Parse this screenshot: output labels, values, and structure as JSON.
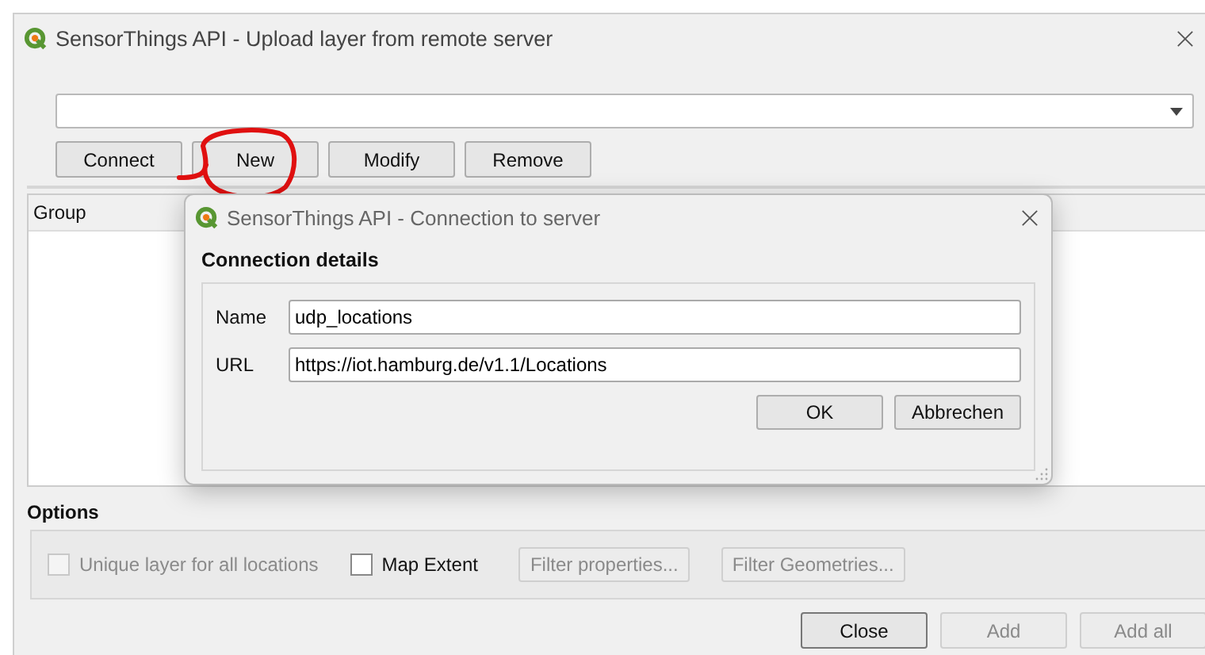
{
  "window": {
    "title": "SensorThings API - Upload layer from remote server"
  },
  "connection_buttons": [
    {
      "label": "Connect",
      "disabled": false
    },
    {
      "label": "New",
      "disabled": false
    },
    {
      "label": "Modify",
      "disabled": false
    },
    {
      "label": "Remove",
      "disabled": false
    }
  ],
  "table": {
    "columns": [
      "Group"
    ]
  },
  "options": {
    "title": "Options",
    "controls": [
      {
        "kind": "checkbox",
        "label": "Unique layer for all locations",
        "checked": false,
        "disabled": true
      },
      {
        "kind": "checkbox",
        "label": "Map Extent",
        "checked": false,
        "disabled": false
      },
      {
        "kind": "button",
        "label": "Filter properties...",
        "disabled": true
      },
      {
        "kind": "button",
        "label": "Filter Geometries...",
        "disabled": true
      }
    ]
  },
  "footer_buttons": [
    {
      "label": "Close",
      "disabled": false
    },
    {
      "label": "Add",
      "disabled": true
    },
    {
      "label": "Add all",
      "disabled": true
    }
  ],
  "annotation": {
    "kind": "circle"
  },
  "dialog": {
    "title": "SensorThings API - Connection to server",
    "section": "Connection details",
    "fields": [
      {
        "label": "Name",
        "value": "udp_locations"
      },
      {
        "label": "URL",
        "value": "https://iot.hamburg.de/v1.1/Locations"
      }
    ],
    "buttons": [
      {
        "label": "OK"
      },
      {
        "label": "Abbrechen"
      }
    ]
  }
}
